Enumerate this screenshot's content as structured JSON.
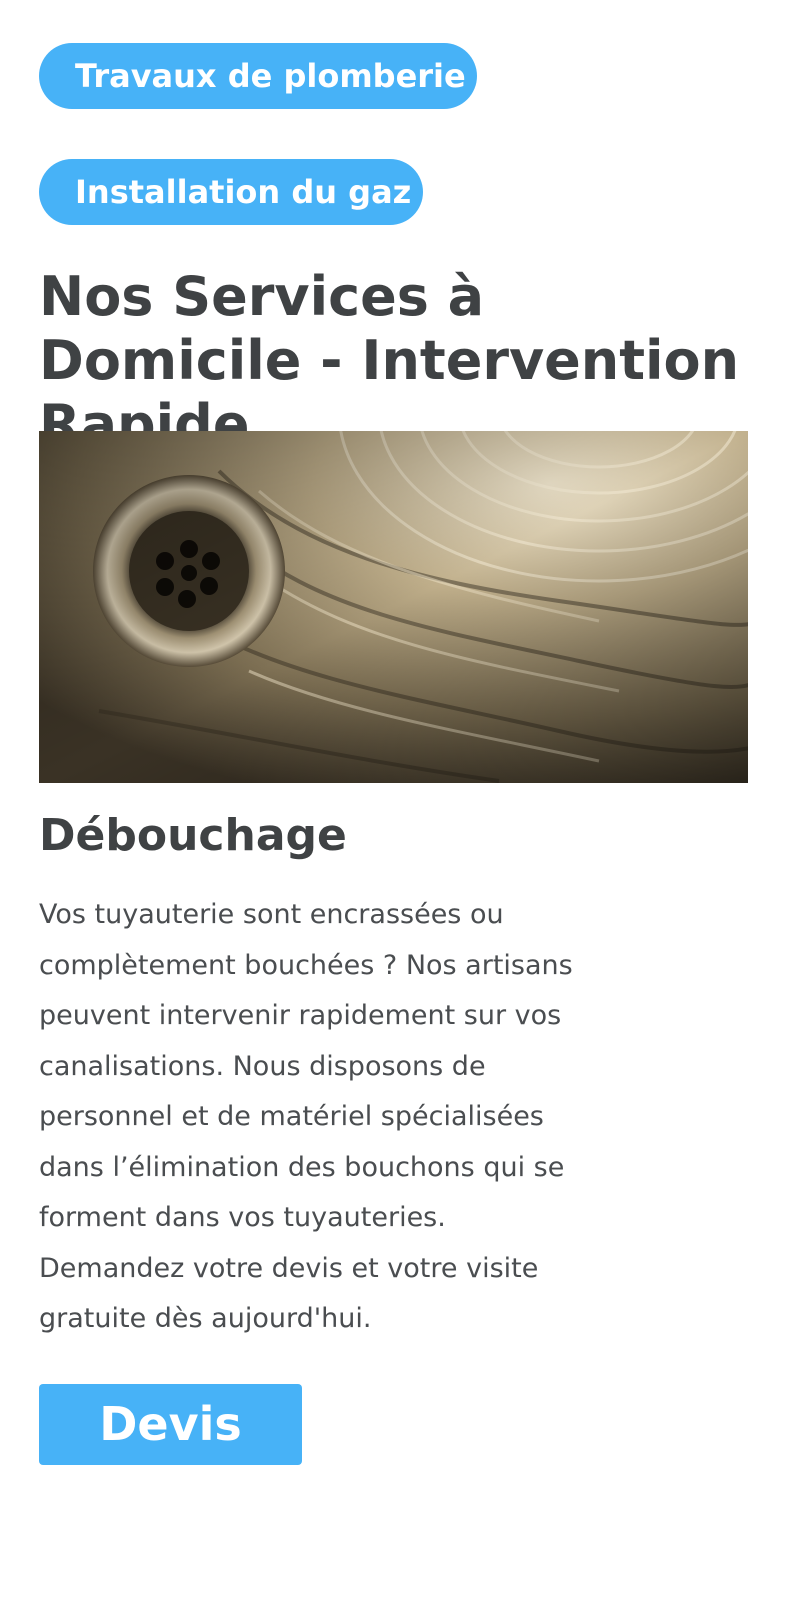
{
  "tags": [
    {
      "label": "Travaux de plomberie"
    },
    {
      "label": "Installation du gaz"
    }
  ],
  "page_title": "Nos Services à Domicile - Intervention Rapide",
  "service": {
    "title": "Débouchage",
    "description_lines": [
      "Vos tuyauterie sont encrassées ou",
      "complètement bouchées ? Nos artisans",
      "peuvent intervenir rapidement sur vos",
      "canalisations. Nous disposons de",
      "personnel et de matériel spécialisées",
      "dans l’élimination des bouchons qui se",
      "forment dans vos tuyauteries.",
      "Demandez votre devis et votre visite",
      "gratuite dès aujourd'hui."
    ],
    "cta_label": "Devis"
  },
  "colors": {
    "accent": "#47b2f7",
    "text": "#3f4244",
    "background": "#ffffff"
  },
  "image": {
    "subject": "sink-drain-photo"
  }
}
